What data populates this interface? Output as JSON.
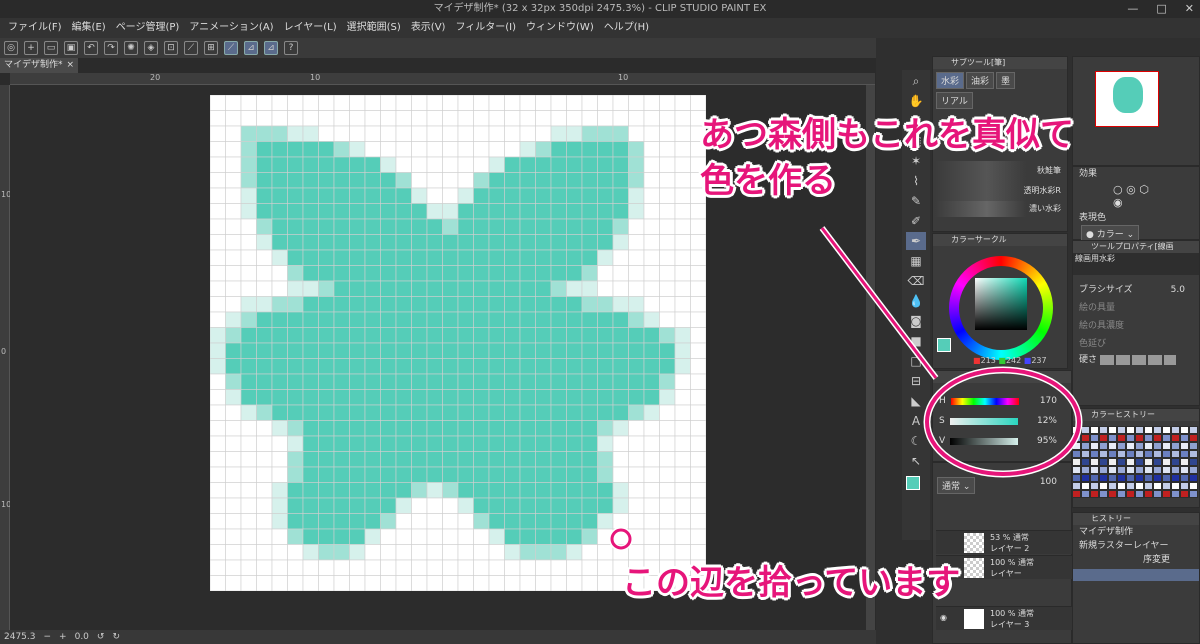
{
  "titlebar": {
    "text": "マイデザ制作* (32 x 32px 350dpi 2475.3%) - CLIP STUDIO PAINT EX",
    "controls": [
      "—",
      "□",
      "✕"
    ]
  },
  "menu": [
    "ファイル(F)",
    "編集(E)",
    "ページ管理(P)",
    "アニメーション(A)",
    "レイヤー(L)",
    "選択範囲(S)",
    "表示(V)",
    "フィルター(I)",
    "ウィンドウ(W)",
    "ヘルプ(H)"
  ],
  "toolbar": {
    "icons": [
      "app-icon",
      "new-icon",
      "open-icon",
      "save-icon",
      "undo-icon",
      "redo-icon",
      "clear-icon",
      "fill-icon",
      "transform-icon",
      "snap-ruler-icon",
      "snap-grid-icon",
      "snap-special-icon",
      "ruler-icon",
      "ruler-edit-icon",
      "help-icon"
    ]
  },
  "doc_tab": {
    "label": "マイデザ制作*",
    "close": "×"
  },
  "ruler": {
    "top": [
      "20",
      "10",
      "10"
    ],
    "left": [
      "10",
      "0",
      "10"
    ]
  },
  "status": {
    "zoom": "2475.3",
    "angle": "0.0"
  },
  "pixel_art": {
    "grid_size": 32,
    "colors": {
      "W": "#ffffff",
      "L": "#d6f1ec",
      "M": "#a0e1d5",
      "T": "#55cdb8"
    },
    "rows": [
      "WWWWWWWWWWWWWWWWWWWWWWWWWWWWWWWW",
      "WWWWWWWWWWWWWWWWWWWWWWWWWWWWWWWW",
      "WWMMMLLWWWWWWWWWWWWWWWLLMMMWWWWW",
      "WWMTTTTTMLWWWWWWWWWWLMTTTTTMWWWW",
      "WWMTTTTTTTTLWWWWWWLTTTTTTTTMWWWW",
      "WWMTTTTTTTTTMWWWWMTTTTTTTTTMWWWW",
      "WWLTTTTTTTTTTLWWLTTTTTTTTTTLWWWW",
      "WWLTTTTTTTTTTTLLTTTTTTTTTTTLWWWW",
      "WWWMTTTTTTTTTTTMTTTTTTTTTTMWWWWW",
      "WWWLTTTTTTTTTTTTTTTTTTTTTTLWWWWW",
      "WWWWLTTTTTTTTTTTTTTTTTTTTLWWWWWW",
      "WWWWWMTTTTTTTTTTTTTTTTTTMWWWWWWW",
      "WWWWWLLMTTTTTTTTTTTTTTMLLWWWWWWW",
      "WWLLMMTTTTTTTTTTTTTTTTTTMMLLWWWW",
      "WLMTTTTTTTTTTTTTTTTTTTTTTTTMLWWW",
      "LMTTTTTTTTTTTTTTTTTTTTTTTTTTTMLW",
      "LTTTTTTTTTTTTTTTTTTTTTTTTTTTTTLW",
      "LTTTTTTTTTTTTTTTTTTTTTTTTTTTTTLW",
      "WMTTTTTTTTTTTTTTTTTTTTTTTTTTTMWW",
      "WLTTTTTTTTTTTTTTTTTTTTTTTTTTTLWW",
      "WWLMTTTTTTTTTTTTTTTTTTTTTTTMLWWW",
      "WWWWLMTTTTTTTTTTTTTTTTTTTMLWWWWW",
      "WWWWWLTTTTTTTTTTTTTTTTTTTLWWWWWW",
      "WWWWWMTTTTTTTTTTTTTTTTTTTMWWWWWW",
      "WWWWWMTTTTTTTTTTTTTTTTTTTMWWWWWW",
      "WWWWLTTTTTTTTMLMTTTTTTTTTTLWWWWW",
      "WWWWLTTTTTTTLWWWLTTTTTTTTTLWWWWW",
      "WWWWLTTTTTTMWWWWWMTTTTTTTLWWWWWW",
      "WWWWWMTTTTLWWWWWWWLTTTTTMWWWWWWW",
      "WWWWWWLMMLWWWWWWWWWLMMMLWWWWWWWW",
      "WWWWWWWWWWWWWWWWWWWWWWWWWWWWWWWW",
      "WWWWWWWWWWWWWWWWWWWWWWWWWWWWWWWW"
    ]
  },
  "subtool": {
    "header": "サブツール[筆]",
    "tabs": [
      "水彩",
      "油彩",
      "墨",
      "リアル"
    ],
    "brushes": [
      "秋鮭筆",
      "透明水彩R",
      "濃い水彩"
    ]
  },
  "color_circle": {
    "header": "カラーサークル",
    "r": "213",
    "g": "242",
    "b": "237",
    "main_color": "#55cdb8"
  },
  "hsv": {
    "h_label": "H",
    "h_value": "170",
    "s_label": "S",
    "s_value": "12%",
    "v_label": "V",
    "v_value": "95%"
  },
  "effect": {
    "label": "効果",
    "expression_label": "表現色",
    "expression_value": "カラー"
  },
  "tool_property": {
    "header": "ツールプロパティ[線画",
    "brush_name": "線画用水彩",
    "size_label": "ブラシサイズ",
    "size_value": "5.0",
    "paint_amount": "絵の具量",
    "paint_density": "絵の具濃度",
    "color_stretch": "色延び",
    "hardness": "硬さ"
  },
  "color_history": {
    "header": "カラーヒストリー"
  },
  "layers": {
    "blend": "通常",
    "opacity": "100",
    "items": [
      {
        "mode": "53 % 通常",
        "name": "レイヤー 2"
      },
      {
        "mode": "100 % 通常",
        "name": "レイヤー"
      },
      {
        "mode": "100 % 通常",
        "name": "レイヤー 3"
      }
    ]
  },
  "history": {
    "header": "ヒストリー",
    "items": [
      "マイデザ制作",
      "新規ラスターレイヤー",
      "序変更"
    ]
  },
  "annotations": {
    "top": "あつ森側もこれを真似て\n色を作る",
    "bottom": "この辺を拾っています",
    "accent": "#e6157a"
  }
}
